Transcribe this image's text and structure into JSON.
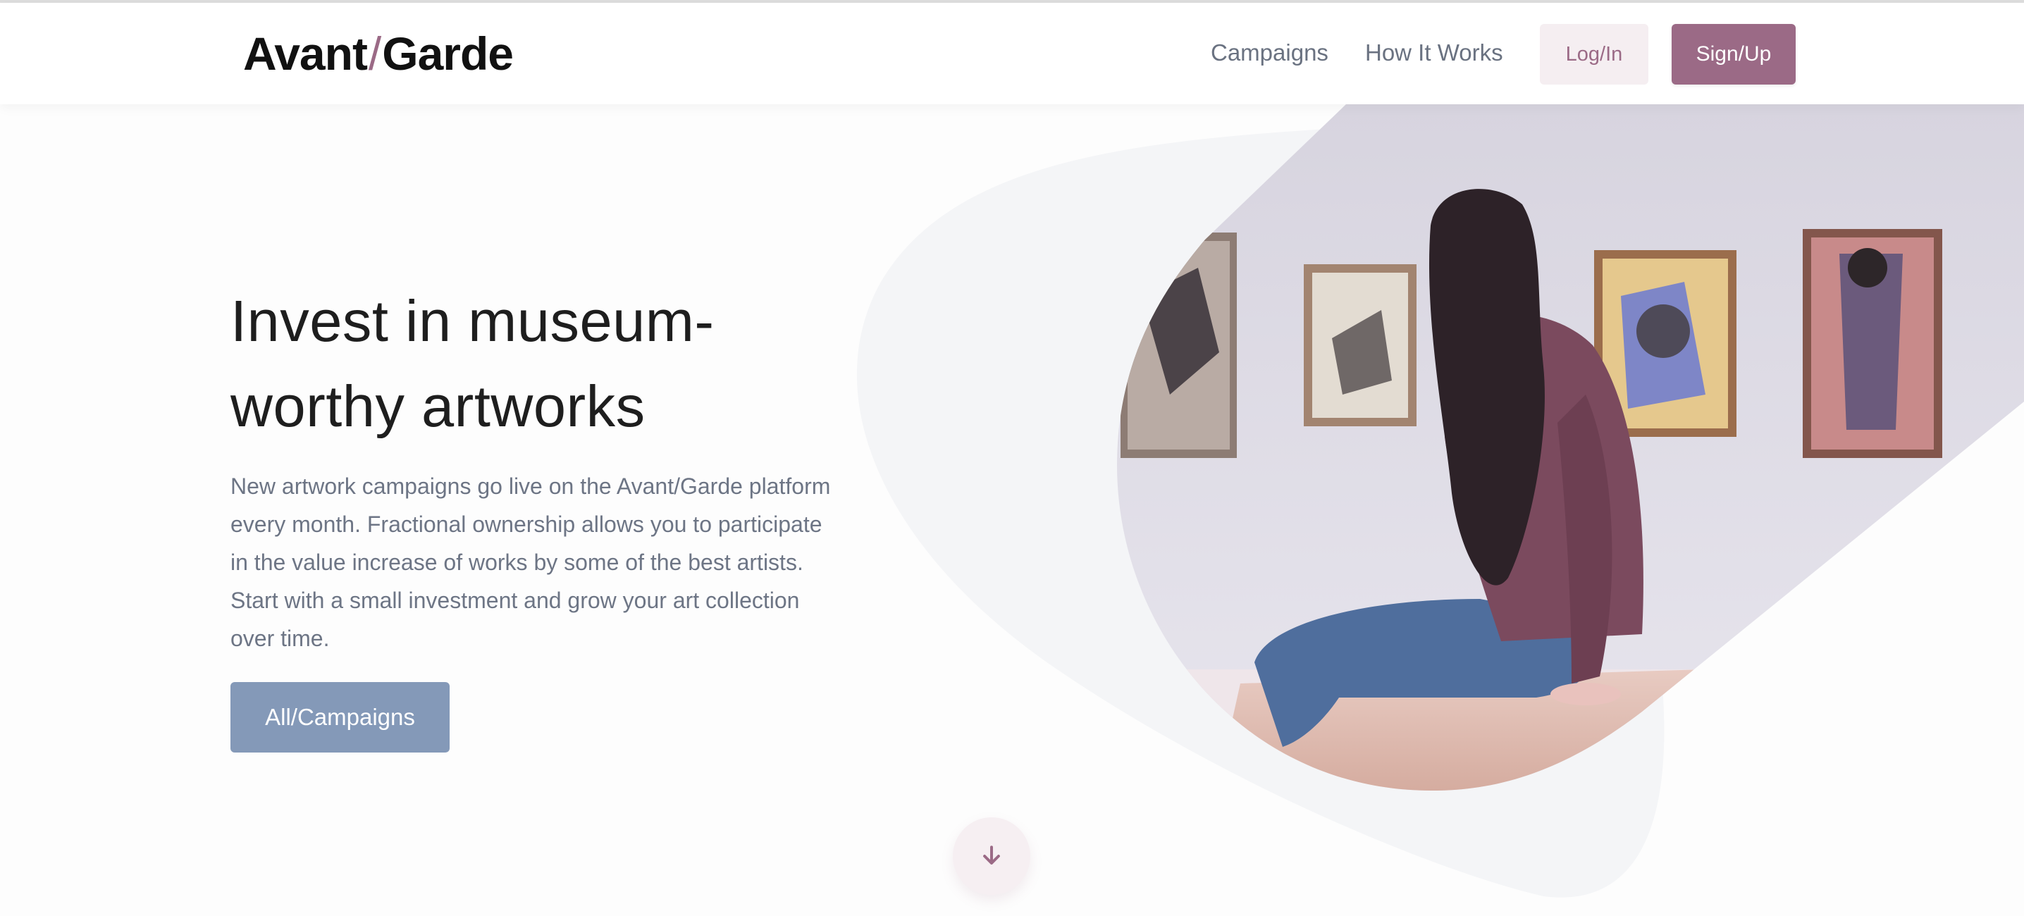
{
  "header": {
    "logo_part1": "Avant",
    "logo_slash": "/",
    "logo_part2": "Garde",
    "nav": {
      "campaigns": "Campaigns",
      "how_it_works": "How It Works"
    },
    "login_label": "Log/In",
    "signup_label": "Sign/Up"
  },
  "hero": {
    "title": "Invest in museum-worthy artworks",
    "text": "New artwork campaigns go live on the Avant/Garde platform every month. Fractional ownership allows you to participate in the value increase of works by some of the best artists. Start with a small investment and grow your art collection over time.",
    "cta_label": "All/Campaigns"
  },
  "colors": {
    "accent": "#9b6a86",
    "accent_light": "#f5eef1",
    "cta": "#8499b8",
    "text_muted": "#6d7585",
    "blob": "#f4f5f7"
  },
  "icons": {
    "scroll": "arrow-down-icon"
  }
}
